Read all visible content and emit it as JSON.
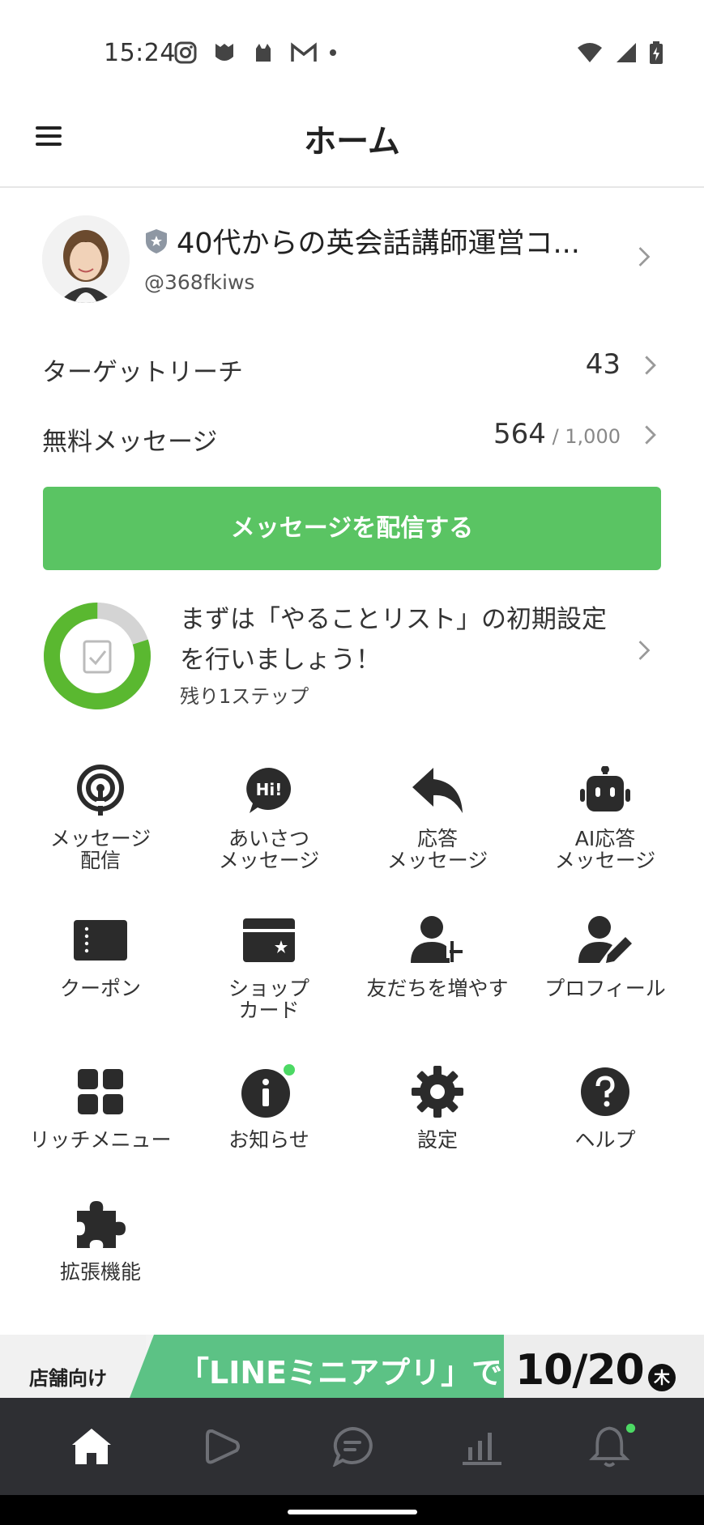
{
  "status_bar": {
    "time": "15:24"
  },
  "header": {
    "title": "ホーム"
  },
  "account": {
    "name": "40代からの英会話講師運営コ...",
    "id": "@368fkiws"
  },
  "stats": [
    {
      "label": "ターゲットリーチ",
      "value": "43",
      "suffix": ""
    },
    {
      "label": "無料メッセージ",
      "value": "564",
      "suffix": " / 1,000"
    }
  ],
  "primary_action": {
    "label": "メッセージを配信する"
  },
  "todo": {
    "title": "まずは「やることリスト」の初期設定を行いましょう！",
    "remaining": "残り1ステップ",
    "progress": 0.8
  },
  "features": [
    {
      "label": "メッセージ\n配信",
      "icon": "broadcast-icon"
    },
    {
      "label": "あいさつ\nメッセージ",
      "icon": "greeting-icon"
    },
    {
      "label": "応答\nメッセージ",
      "icon": "reply-icon"
    },
    {
      "label": "AI応答\nメッセージ",
      "icon": "robot-icon"
    },
    {
      "label": "クーポン",
      "icon": "coupon-icon"
    },
    {
      "label": "ショップ\nカード",
      "icon": "shop-card-icon"
    },
    {
      "label": "友だちを増やす",
      "icon": "add-friend-icon"
    },
    {
      "label": "プロフィール",
      "icon": "profile-icon"
    },
    {
      "label": "リッチメニュー",
      "icon": "rich-menu-icon"
    },
    {
      "label": "お知らせ",
      "icon": "info-icon"
    },
    {
      "label": "設定",
      "icon": "gear-icon"
    },
    {
      "label": "ヘルプ",
      "icon": "help-icon"
    },
    {
      "label": "拡張機能",
      "icon": "puzzle-icon"
    }
  ],
  "banner": {
    "left_text": "店舗向け",
    "mid_text": "「LINEミニアプリ」で",
    "right_text": "10/20",
    "weekday": "木"
  },
  "bottom_nav": [
    "home-icon",
    "play-icon",
    "chat-icon",
    "analytics-icon",
    "notifications-icon"
  ],
  "colors": {
    "accent": "#5ac463",
    "nav_bg": "#2e2f33",
    "badge": "#4cd964"
  }
}
